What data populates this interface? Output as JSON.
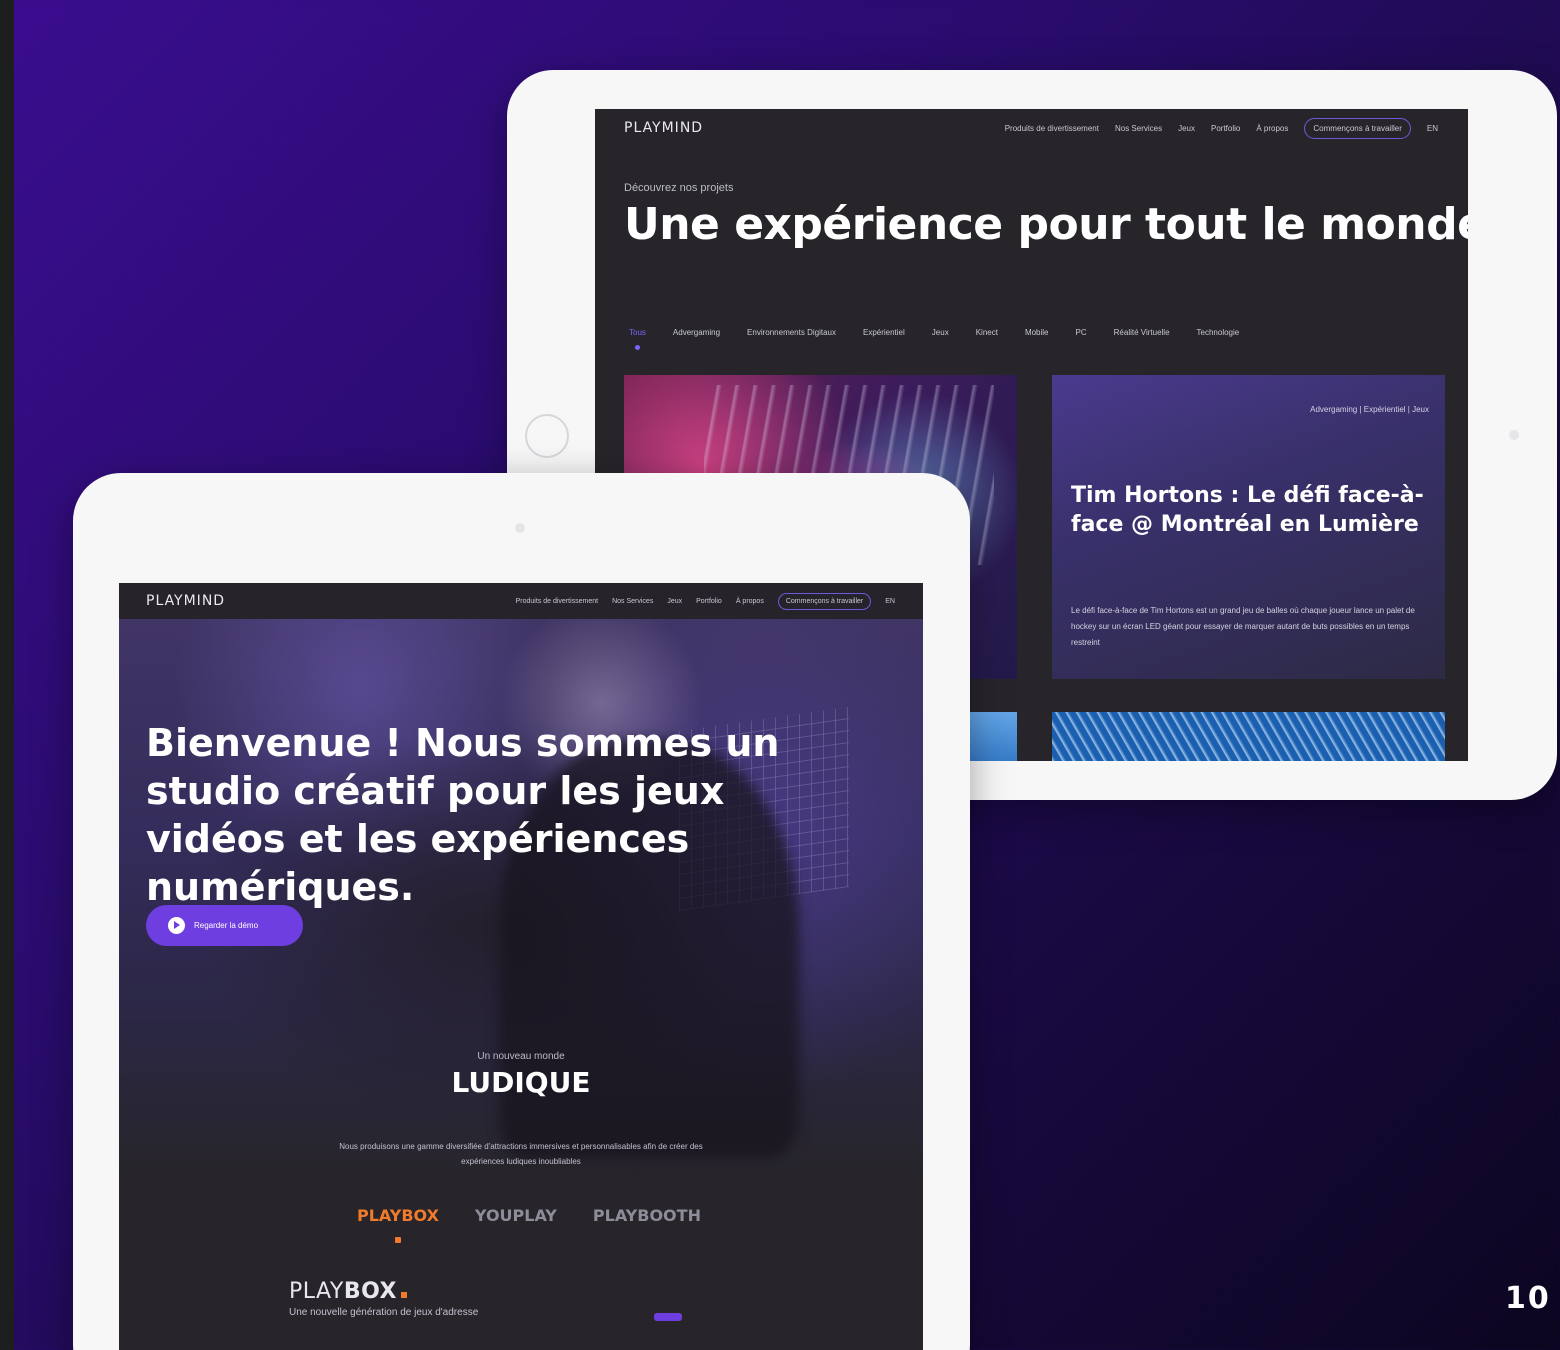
{
  "page_number": "10",
  "back_screen": {
    "logo": "PLAYMIND",
    "nav": [
      "Produits de divertissement",
      "Nos Services",
      "Jeux",
      "Portfolio",
      "À propos"
    ],
    "nav_cta": "Commençons à travailler",
    "lang": "EN",
    "kicker": "Découvrez nos projets",
    "title": "Une expérience pour tout le monde",
    "filters": [
      "Tous",
      "Advergaming",
      "Environnements Digitaux",
      "Expérientiel",
      "Jeux",
      "Kinect",
      "Mobile",
      "PC",
      "Réalité Virtuelle",
      "Technologie"
    ],
    "card": {
      "tags": "Advergaming | Expérientiel | Jeux",
      "title": "Tim Hortons : Le défi face-à-face @ Montréal en Lumière",
      "description": "Le défi face-à-face de Tim Hortons est un grand jeu de balles où chaque joueur lance un palet de hockey sur un écran LED géant pour essayer de marquer autant de buts possibles en un temps restreint"
    }
  },
  "front_screen": {
    "logo": "PLAYMIND",
    "nav": [
      "Produits de divertissement",
      "Nos Services",
      "Jeux",
      "Portfolio",
      "À propos"
    ],
    "nav_cta": "Commençons à travailler",
    "lang": "EN",
    "hero_title": "Bienvenue ! Nous sommes un studio créatif pour les jeux vidéos et les expériences numériques.",
    "demo_button": "Regarder la démo",
    "section_kicker": "Un nouveau monde",
    "section_title": "LUDIQUE",
    "section_desc": "Nous produisons une gamme diversifiée d'attractions immersives et personnalisables afin de créer des expériences ludiques inoubliables",
    "product_tabs": [
      "PLAYBOX",
      "YOUPLAY",
      "PLAYBOOTH"
    ],
    "playbox_logo_light": "PLAY",
    "playbox_logo_bold": "BOX",
    "playbox_sub": "Une nouvelle génération de jeux d'adresse"
  },
  "colors": {
    "accent_purple": "#6f3ee0",
    "accent_orange": "#f07b2c",
    "screen_bg": "#27252a",
    "background_start": "#3a0d8f",
    "background_end": "#0c0620"
  }
}
